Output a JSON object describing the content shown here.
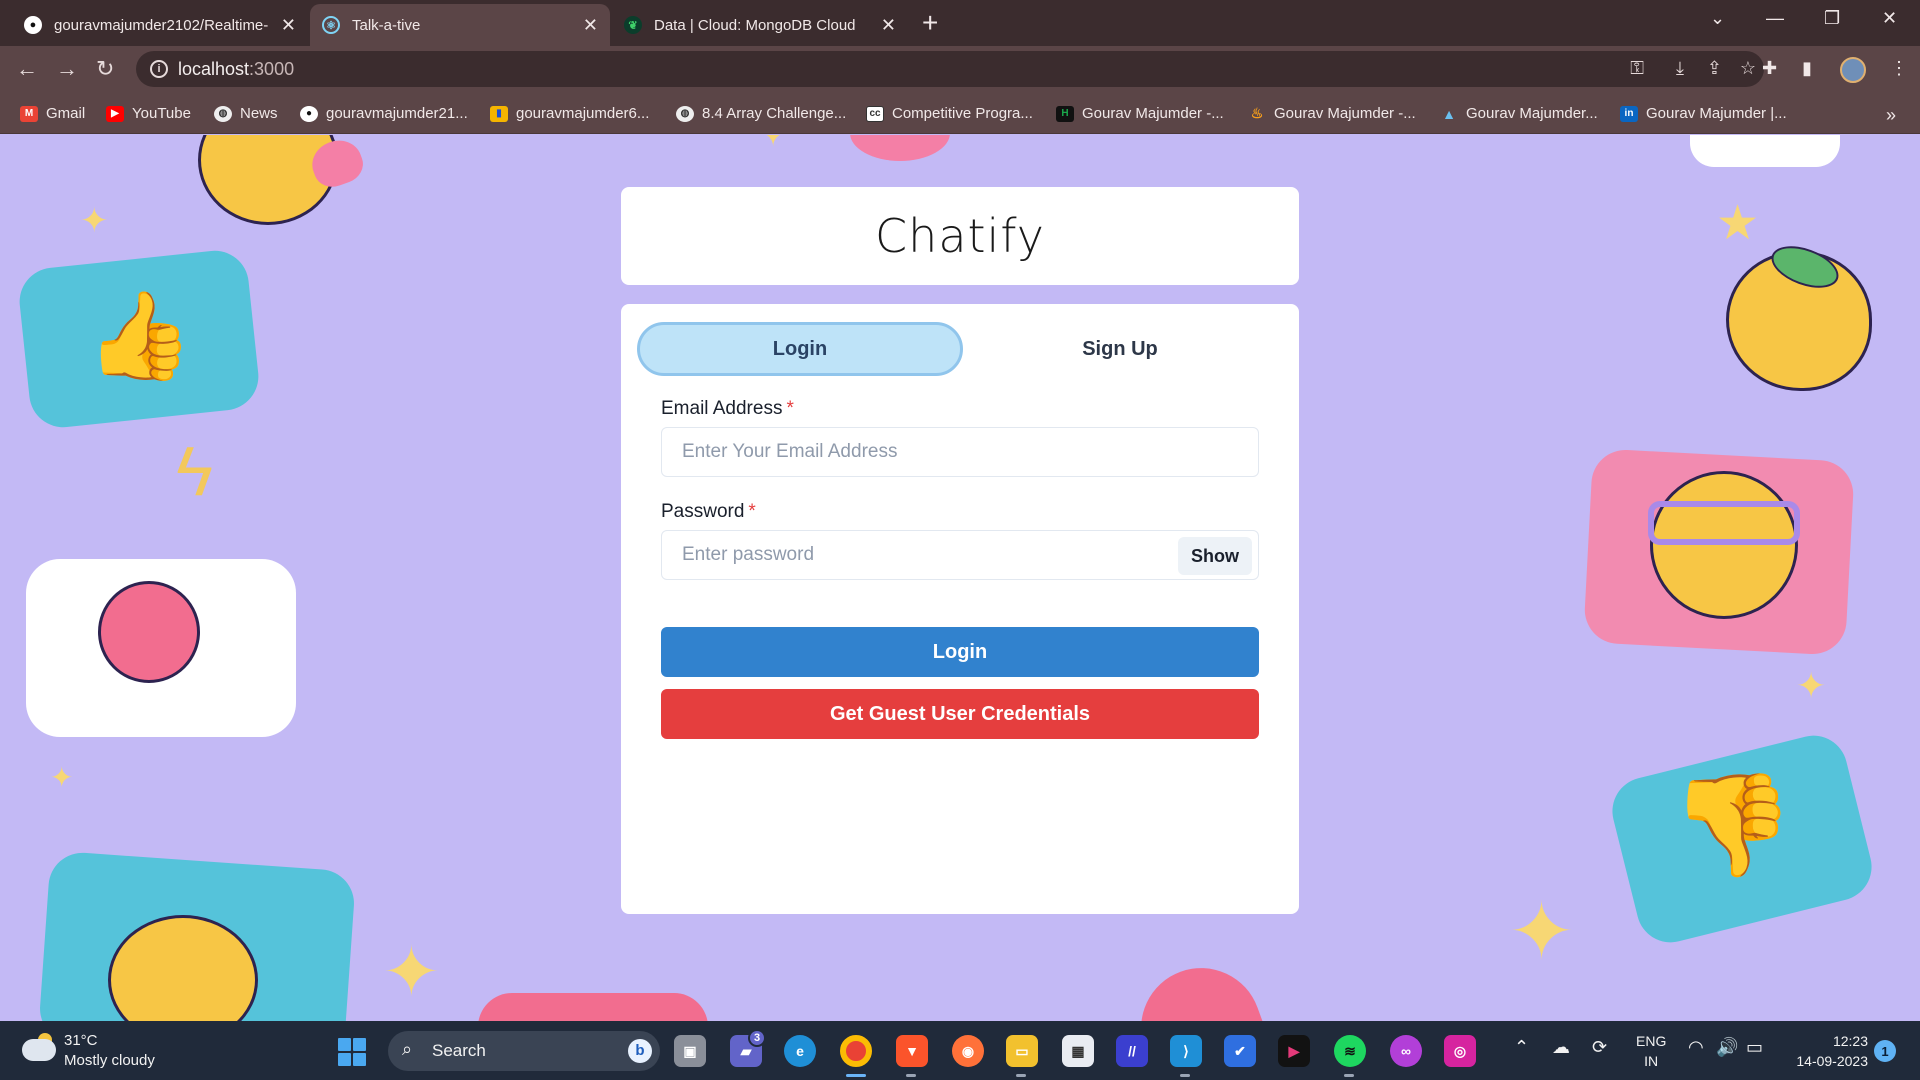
{
  "browser": {
    "tabs": [
      {
        "title": "gouravmajumder2102/Realtime-",
        "active": false
      },
      {
        "title": "Talk-a-tive",
        "active": true
      },
      {
        "title": "Data | Cloud: MongoDB Cloud",
        "active": false
      }
    ],
    "url_host": "localhost",
    "url_port": ":3000",
    "bookmarks": [
      {
        "label": "Gmail",
        "icon": "gmail-icon",
        "color": "#ea4335"
      },
      {
        "label": "YouTube",
        "icon": "youtube-icon",
        "color": "#ff0000"
      },
      {
        "label": "News",
        "icon": "globe-icon",
        "color": "#ffffff"
      },
      {
        "label": "gouravmajumder21...",
        "icon": "github-icon",
        "color": "#ffffff"
      },
      {
        "label": "gouravmajumder6...",
        "icon": "bar-chart-icon",
        "color": "#f5b400"
      },
      {
        "label": "8.4 Array Challenge...",
        "icon": "globe-icon",
        "color": "#ffffff"
      },
      {
        "label": "Competitive Progra...",
        "icon": "cc-icon",
        "color": "#ffffff"
      },
      {
        "label": "Gourav Majumder -...",
        "icon": "hackerrank-icon",
        "color": "#1ba94c"
      },
      {
        "label": "Gourav Majumder -...",
        "icon": "leetcode-icon",
        "color": "#f89f1b"
      },
      {
        "label": "Gourav Majumder...",
        "icon": "mountain-icon",
        "color": "#6ac0f0"
      },
      {
        "label": "Gourav Majumder |...",
        "icon": "linkedin-icon",
        "color": "#0a66c2"
      }
    ]
  },
  "app": {
    "title": "Chatify",
    "tabs": {
      "login": "Login",
      "signup": "Sign Up",
      "active": "login"
    },
    "email": {
      "label": "Email Address",
      "required_mark": "*",
      "placeholder": "Enter Your Email Address",
      "value": ""
    },
    "password": {
      "label": "Password",
      "required_mark": "*",
      "placeholder": "Enter password",
      "value": "",
      "toggle_label": "Show"
    },
    "login_button": "Login",
    "guest_button": "Get Guest User Credentials",
    "colors": {
      "background": "#c3b9f5",
      "primary": "#3182ce",
      "danger": "#e53e3e",
      "tab_active": "#bee3f8"
    }
  },
  "taskbar": {
    "weather_temp": "31°C",
    "weather_desc": "Mostly cloudy",
    "search_label": "Search",
    "teams_badge": "3",
    "lang_line1": "ENG",
    "lang_line2": "IN",
    "time": "12:23",
    "date": "14-09-2023",
    "notification_count": "1"
  }
}
